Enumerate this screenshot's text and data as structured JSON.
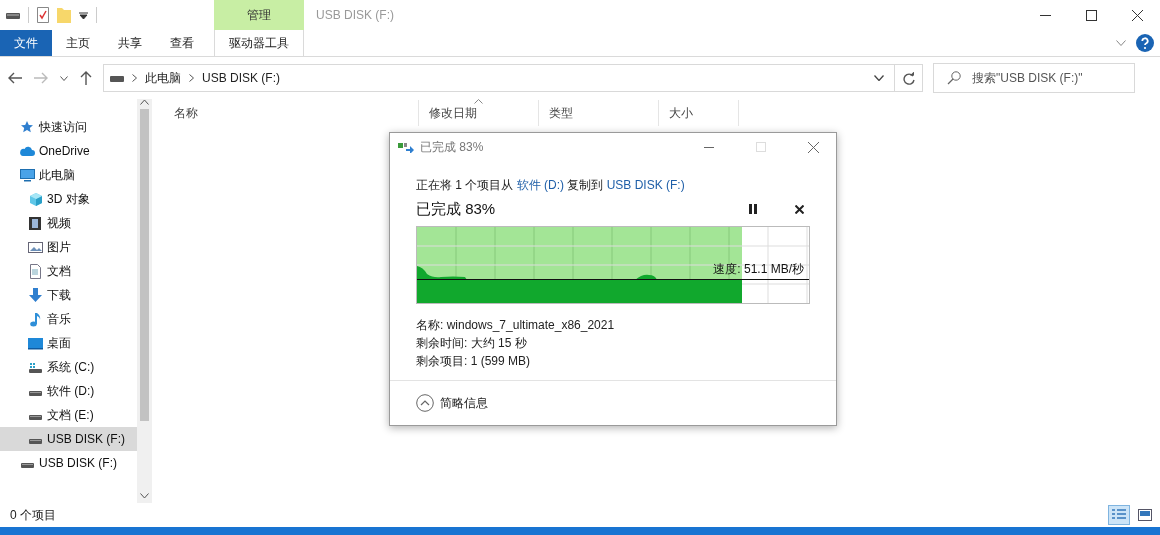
{
  "title_bar": {
    "title": "USB DISK (F:)",
    "context_group": "管理"
  },
  "ribbon": {
    "tabs": [
      {
        "label": "文件",
        "kind": "file"
      },
      {
        "label": "主页",
        "kind": "tab"
      },
      {
        "label": "共享",
        "kind": "tab"
      },
      {
        "label": "查看",
        "kind": "tab"
      },
      {
        "label": "驱动器工具",
        "kind": "context"
      }
    ]
  },
  "address_bar": {
    "path": [
      "此电脑",
      "USB DISK (F:)"
    ]
  },
  "search": {
    "placeholder": "搜索\"USB DISK (F:)\""
  },
  "sidebar": {
    "items": [
      {
        "label": "快速访问",
        "kind": "star",
        "selected": false
      },
      {
        "label": "OneDrive",
        "kind": "cloud",
        "selected": false
      },
      {
        "label": "此电脑",
        "kind": "pc",
        "selected": false,
        "children": [
          {
            "label": "3D 对象",
            "kind": "cube",
            "selected": false
          },
          {
            "label": "视频",
            "kind": "video",
            "selected": false
          },
          {
            "label": "图片",
            "kind": "picture",
            "selected": false
          },
          {
            "label": "文档",
            "kind": "document",
            "selected": false
          },
          {
            "label": "下载",
            "kind": "download",
            "selected": false
          },
          {
            "label": "音乐",
            "kind": "music",
            "selected": false
          },
          {
            "label": "桌面",
            "kind": "desktop",
            "selected": false
          },
          {
            "label": "系统 (C:)",
            "kind": "system-drive",
            "selected": false
          },
          {
            "label": "软件 (D:)",
            "kind": "drive",
            "selected": false
          },
          {
            "label": "文档 (E:)",
            "kind": "drive",
            "selected": false
          },
          {
            "label": "USB DISK (F:)",
            "kind": "drive",
            "selected": true
          }
        ]
      },
      {
        "label": "USB DISK (F:)",
        "kind": "drive",
        "selected": false
      }
    ]
  },
  "file_list": {
    "columns": [
      {
        "label": "名称",
        "sorted": false
      },
      {
        "label": "修改日期",
        "sorted": true
      },
      {
        "label": "类型",
        "sorted": false
      },
      {
        "label": "大小",
        "sorted": false
      }
    ]
  },
  "copy_dialog": {
    "title": "已完成 83%",
    "message": {
      "prefix": "正在将 1 个项目从",
      "source": "软件 (D:)",
      "middle": "复制到",
      "destination": "USB DISK (F:)"
    },
    "heading": "已完成 83%",
    "level": 0.83,
    "speed": "速度: 51.1 MB/秒",
    "details": [
      "名称: windows_7_ultimate_x86_2021",
      "剩余时间: 大约 15 秒",
      "剩余项目: 1 (599 MB)"
    ],
    "toggle": "简略信息"
  },
  "status_bar": {
    "text": "0 个项目"
  }
}
